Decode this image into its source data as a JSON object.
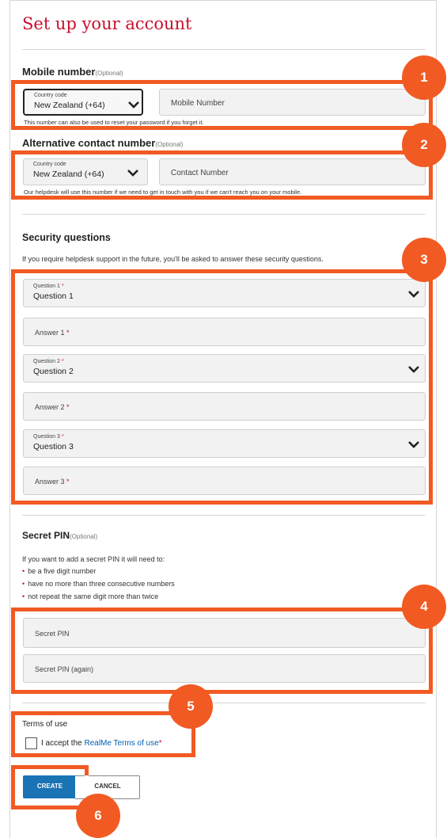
{
  "page": {
    "title": "Set up your account"
  },
  "mobile": {
    "heading": "Mobile number",
    "optional": "(Optional)",
    "country_label": "Country code",
    "country_value": "New Zealand (+64)",
    "number_placeholder": "Mobile Number",
    "hint": "This number can also be used to reset your password if you forget it."
  },
  "alternative": {
    "heading": "Alternative contact number",
    "optional": "(Optional)",
    "country_label": "Country code",
    "country_value": "New Zealand (+64)",
    "number_placeholder": "Contact Number",
    "hint": "Our helpdesk will use this number if we need to get in touch with you if we can't reach you on your mobile."
  },
  "security": {
    "heading": "Security questions",
    "intro": "If you require helpdesk support in the future, you'll be asked to answer these security questions.",
    "questions": [
      {
        "label": "Question 1",
        "value": "Question 1",
        "answer_placeholder": "Answer 1"
      },
      {
        "label": "Question 2",
        "value": "Question 2",
        "answer_placeholder": "Answer 2"
      },
      {
        "label": "Question 3",
        "value": "Question 3",
        "answer_placeholder": "Answer 3"
      }
    ],
    "required_mark": "*"
  },
  "pin": {
    "heading": "Secret PIN",
    "optional": "(Optional)",
    "intro": "If you want to add a secret PIN it will need to:",
    "rules": [
      "be a five digit number",
      "have no more than three consecutive numbers",
      "not repeat the same digit more than twice"
    ],
    "bullet": "•",
    "pin_placeholder": "Secret PIN",
    "pin_again_placeholder": "Secret PIN (again)"
  },
  "terms": {
    "heading": "Terms of use",
    "accept_prefix": "I accept the ",
    "link_text": "RealMe Terms of use",
    "required_mark": "*"
  },
  "buttons": {
    "create": "CREATE",
    "cancel": "CANCEL"
  },
  "annotations": [
    "1",
    "2",
    "3",
    "4",
    "5",
    "6"
  ],
  "colors": {
    "accent_red": "#c8102e",
    "callout_orange": "#f15a22",
    "button_blue": "#1a73b5",
    "link_blue": "#005eb8"
  }
}
